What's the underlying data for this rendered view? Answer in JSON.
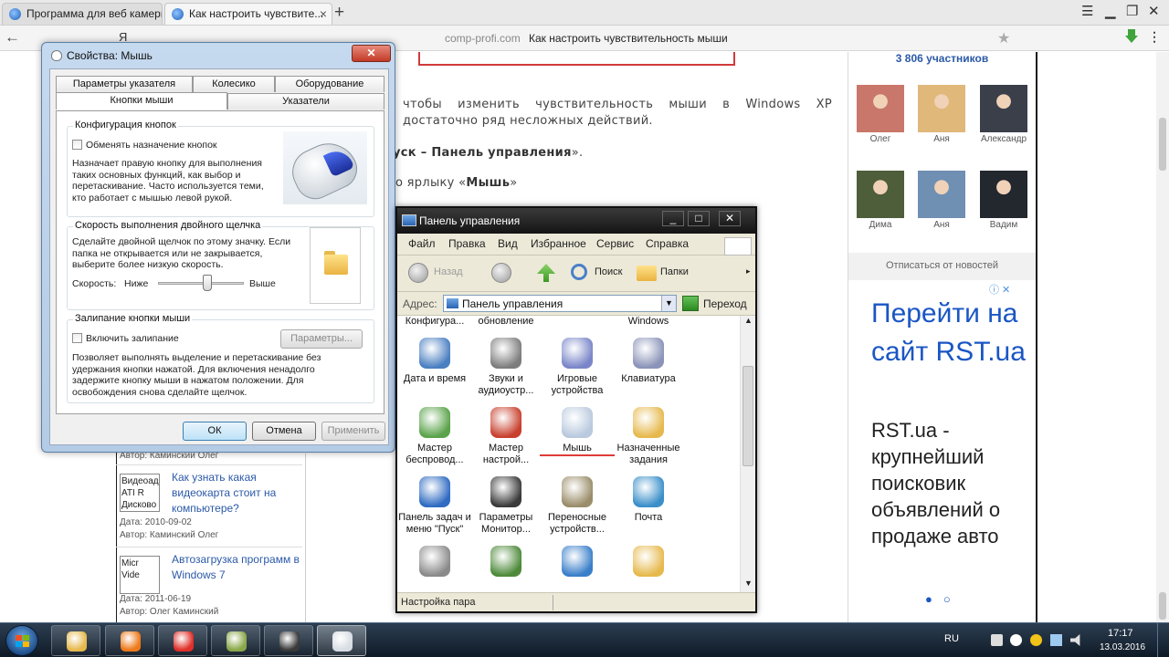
{
  "browser": {
    "tabs": [
      {
        "label": "Программа для веб камеры"
      },
      {
        "label": "Как настроить чувствите..."
      }
    ],
    "address_host": "comp-profi.com",
    "address_title": "Как настроить чувствительность мыши",
    "search_letter": "Я"
  },
  "article": {
    "paragraph": "чтобы изменить чувствительность мыши в Windows XP достаточно ряд несложных действий.",
    "step1_pre": "уск – ",
    "step1_bold": "Панель управления",
    "step1_post": "».",
    "step2_pre": "о ярлыку «",
    "step2_bold": "Мышь",
    "step2_post": "»"
  },
  "sidebar_posts": [
    {
      "thumb_lines": [
        "Видеоад",
        "ATI R",
        "Дисково"
      ],
      "title": "Как узнать какая видеокарта стоит на компьютере?",
      "date": "Дата: 2010-09-02",
      "author": "Автор: Каминский Олег"
    },
    {
      "thumb_lines": [
        "Micr",
        "Vide"
      ],
      "title": "Автозагрузка программ в Windows 7",
      "date": "Дата: 2011-06-19",
      "author": "Автор: Олег Каминский"
    }
  ],
  "sidebar_top_author": "Автор: Каминский Олег",
  "right_col": {
    "members": "3 806 участников",
    "avatars": [
      {
        "name": "Олег",
        "color": "#c9776a"
      },
      {
        "name": "Аня",
        "color": "#e0b87a"
      },
      {
        "name": "Александр",
        "color": "#3a3f4a"
      },
      {
        "name": "Дима",
        "color": "#4e5d3a"
      },
      {
        "name": "Аня",
        "color": "#6f8fb3"
      },
      {
        "name": "Вадим",
        "color": "#23272e"
      }
    ],
    "unsubscribe": "Отписаться от новостей",
    "ad_icons": "ⓘ ✕",
    "ad_title": "Перейти на сайт RST.ua",
    "ad_body": "RST.ua - крупнейший поисковик объявлений о продаже авто"
  },
  "mouse_dialog": {
    "title": "Свойства: Мышь",
    "close": "✕",
    "tabs_back": [
      "Параметры указателя",
      "Колесико",
      "Оборудование"
    ],
    "tabs_front": [
      "Кнопки мыши",
      "Указатели"
    ],
    "group1": {
      "label": "Конфигурация кнопок",
      "checkbox": "Обменять назначение кнопок",
      "desc": "Назначает правую кнопку для выполнения таких основных функций, как выбор и перетаскивание. Часто используется теми, кто работает с мышью левой рукой."
    },
    "group2": {
      "label": "Скорость выполнения двойного щелчка",
      "desc": "Сделайте двойной щелчок по этому значку. Если папка не открывается или не закрывается, выберите более низкую скорость.",
      "speed_label": "Скорость:",
      "low": "Ниже",
      "high": "Выше",
      "slider_value": 0.57
    },
    "group3": {
      "label": "Залипание кнопки мыши",
      "checkbox": "Включить залипание",
      "params": "Параметры...",
      "desc": "Позволяет выполнять выделение и перетаскивание без удержания кнопки нажатой. Для включения ненадолго задержите кнопку мыши в нажатом положении. Для освобождения снова сделайте щелчок."
    },
    "ok": "ОК",
    "cancel": "Отмена",
    "apply": "Применить"
  },
  "control_panel": {
    "title": "Панель управления",
    "controls": [
      "_",
      "□",
      "✕"
    ],
    "menu": [
      "Файл",
      "Правка",
      "Вид",
      "Избранное",
      "Сервис",
      "Справка"
    ],
    "back": "Назад",
    "search": "Поиск",
    "folders": "Папки",
    "address_label": "Адрес:",
    "address_value": "Панель управления",
    "go": "Переход",
    "top_row": [
      "Конфигура...",
      "обновление",
      "Windows"
    ],
    "icons": [
      {
        "label": "Дата и время",
        "color": "#4a7fc1"
      },
      {
        "label": "Звуки и аудиоустр...",
        "color": "#7d7d7d"
      },
      {
        "label": "Игровые устройства",
        "color": "#7a86c9"
      },
      {
        "label": "Клавиатура",
        "color": "#8a93b8"
      },
      {
        "label": "Мастер беспровод...",
        "color": "#5aa34a"
      },
      {
        "label": "Мастер настрой...",
        "color": "#c8402e"
      },
      {
        "label": "Мышь",
        "color": "#b9c9de"
      },
      {
        "label": "Назначенные задания",
        "color": "#e6b94d"
      },
      {
        "label": "Панель задач и меню \"Пуск\"",
        "color": "#2f6bc2"
      },
      {
        "label": "Параметры Монитор...",
        "color": "#3a3a3a"
      },
      {
        "label": "Переносные устройств...",
        "color": "#9a8d6a"
      },
      {
        "label": "Почта",
        "color": "#3a8fc9"
      },
      {
        "label": "",
        "color": "#8a8a8a"
      },
      {
        "label": "",
        "color": "#4e8a3a"
      },
      {
        "label": "",
        "color": "#3a7fc9"
      },
      {
        "label": "",
        "color": "#e6b94d"
      }
    ],
    "status": "Настройка пара"
  },
  "taskbar": {
    "buttons": [
      {
        "name": "explorer",
        "color": "#e6b94d"
      },
      {
        "name": "media-player",
        "color": "#ee7a1a"
      },
      {
        "name": "yandex-browser",
        "color": "#e0302a"
      },
      {
        "name": "notepad",
        "color": "#8aa84a"
      },
      {
        "name": "camera-app",
        "color": "#3a3a3a"
      },
      {
        "name": "mouse-properties",
        "color": "#d8dde3"
      }
    ],
    "lang": "RU",
    "time": "17:17",
    "date": "13.03.2016"
  }
}
